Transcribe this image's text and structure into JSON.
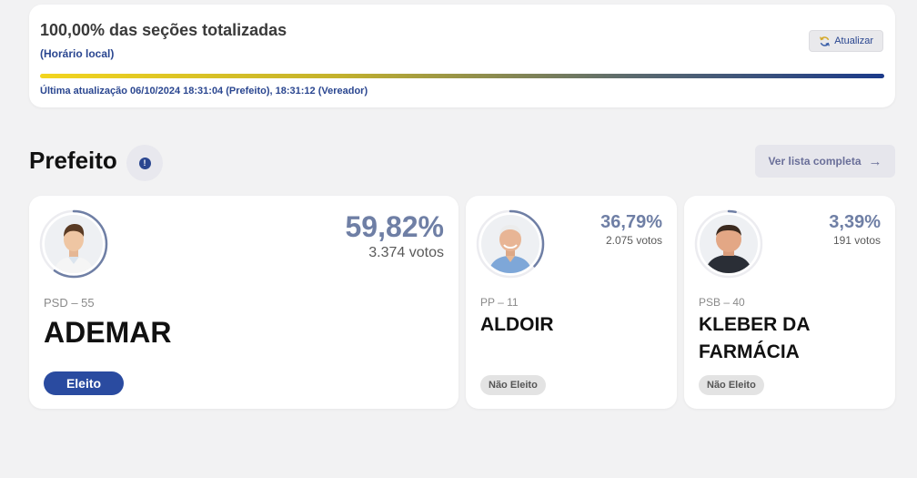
{
  "status": {
    "title": "100,00% das seções totalizadas",
    "subtitle": "(Horário local)",
    "refresh_label": "Atualizar",
    "progress": 1.0,
    "last_update": "Última atualização 06/10/2024 18:31:04 (Prefeito), 18:31:12 (Vereador)"
  },
  "section": {
    "title": "Prefeito",
    "info_symbol": "!",
    "full_list_label": "Ver lista completa",
    "full_list_arrow": "→"
  },
  "candidates": [
    {
      "percent": "59,82%",
      "votes": "3.374 votos",
      "party": "PSD – 55",
      "name": "ADEMAR",
      "status": "Eleito",
      "share": 0.5982
    },
    {
      "percent": "36,79%",
      "votes": "2.075 votos",
      "party": "PP – 11",
      "name": "ALDOIR",
      "status": "Não Eleito",
      "share": 0.3679
    },
    {
      "percent": "3,39%",
      "votes": "191 votos",
      "party": "PSB – 40",
      "name_line1": "KLEBER DA",
      "name_line2": "FARMÁCIA",
      "status": "Não Eleito",
      "share": 0.0339
    }
  ],
  "colors": {
    "accent": "#2a4ba0",
    "percent_text": "#6f7fa5",
    "ring": "#6f7fa5"
  }
}
